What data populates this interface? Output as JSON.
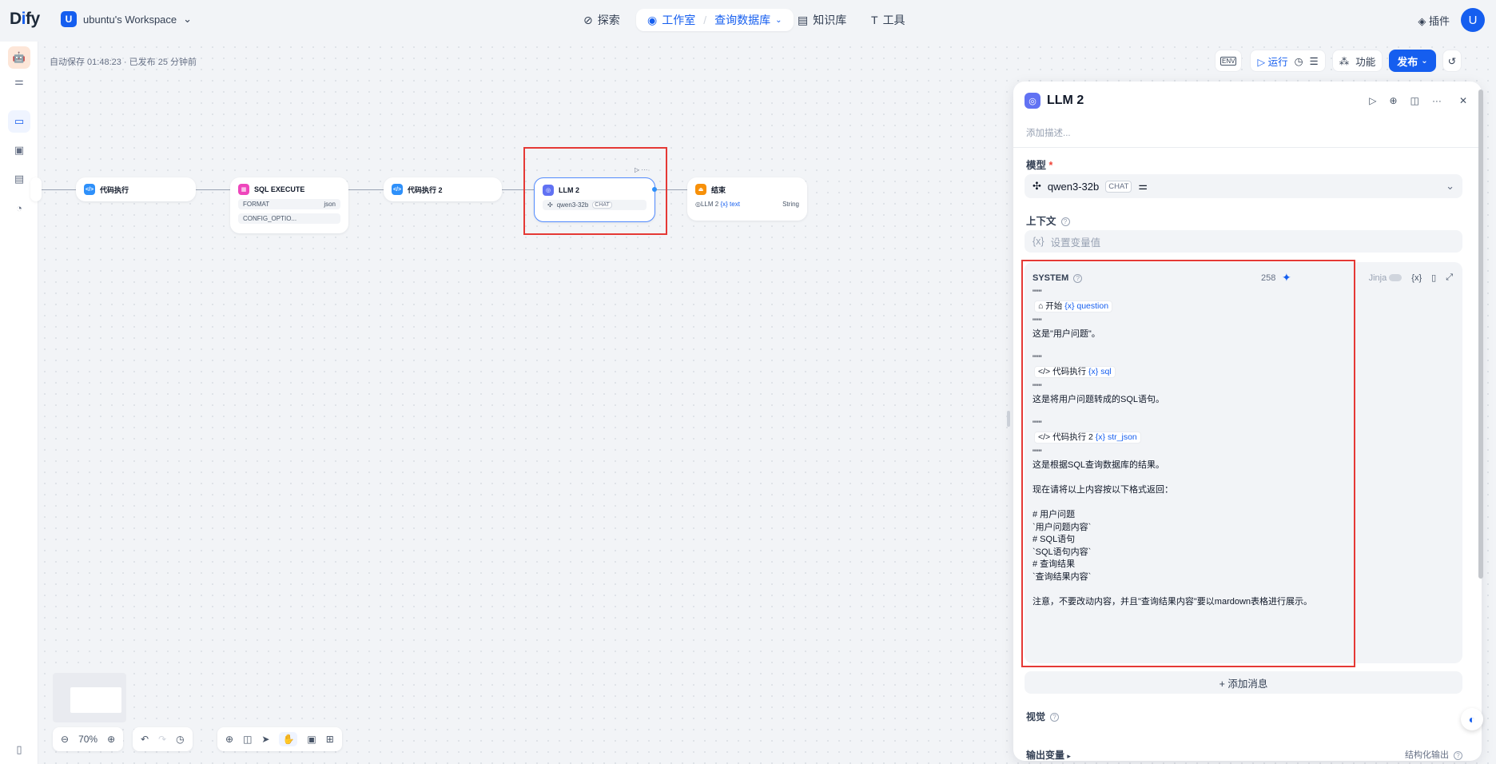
{
  "app": {
    "logo_text": "Dify",
    "workspace_initial": "U",
    "workspace_name": "ubuntu's Workspace"
  },
  "nav": {
    "explore": "探索",
    "studio": "工作室",
    "app_name": "查询数据库",
    "knowledge": "知识库",
    "tools": "工具",
    "plugins": "插件",
    "user_initial": "U"
  },
  "canvas": {
    "autosave": "自动保存 01:48:23 · 已发布 25 分钟前",
    "toolbar": {
      "env": "ENV",
      "run": "运行",
      "features": "功能",
      "publish": "发布"
    },
    "zoom": "70%"
  },
  "nodes": {
    "code1": {
      "title": "代码执行"
    },
    "sql": {
      "title": "SQL EXECUTE",
      "rows": [
        {
          "k": "FORMAT",
          "v": "json"
        },
        {
          "k": "CONFIG_OPTIO...",
          "v": ""
        }
      ]
    },
    "code2": {
      "title": "代码执行 2"
    },
    "llm": {
      "title": "LLM 2",
      "model": "qwen3-32b",
      "badge": "CHAT"
    },
    "end": {
      "title": "结束",
      "var_node": "LLM 2",
      "var_name": "text",
      "var_type": "String"
    }
  },
  "panel": {
    "title": "LLM 2",
    "desc_placeholder": "添加描述...",
    "model_label": "模型",
    "required": "*",
    "model_name": "qwen3-32b",
    "model_badge": "CHAT",
    "context_label": "上下文",
    "context_placeholder": "设置变量值",
    "system_label": "SYSTEM",
    "char_count": "258",
    "jinja": "Jinja",
    "add_message": "+ 添加消息",
    "vision_label": "视觉",
    "output_label": "输出变量",
    "structured": "结构化输出"
  },
  "prompt": {
    "quote": "\"\"\"",
    "start_node": "开始",
    "start_var": "question",
    "line1": "这是\"用户问题\"。",
    "code_node": "代码执行",
    "code_var": "sql",
    "line2": "这是将用户问题转成的SQL语句。",
    "code2_node": "代码执行 2",
    "code2_var": "str_json",
    "line3": "这是根据SQL查询数据库的结果。",
    "line4": "现在请将以上内容按以下格式返回：",
    "f1": "# 用户问题",
    "f2": "`用户问题内容`",
    "f3": "# SQL语句",
    "f4": "`SQL语句内容`",
    "f5": "# 查询结果",
    "f6": "`查询结果内容`",
    "note": "注意，不要改动内容，并且\"查询结果内容\"要以mardown表格进行展示。"
  },
  "colors": {
    "accent": "#155eef",
    "highlight": "#e53935"
  }
}
